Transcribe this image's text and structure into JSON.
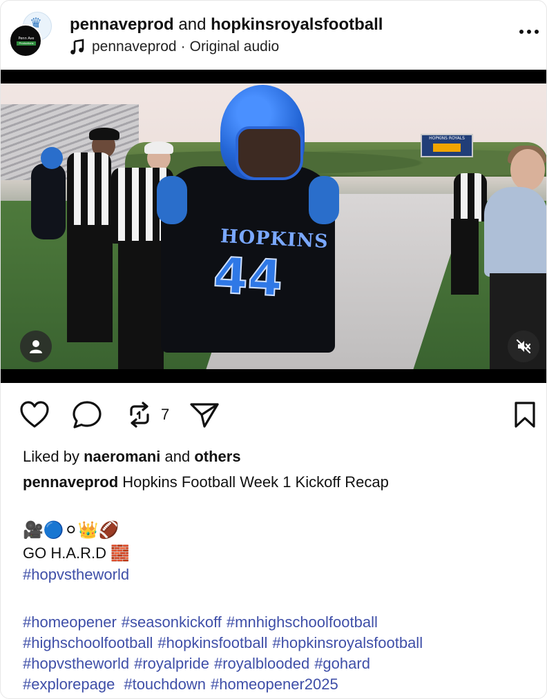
{
  "header": {
    "account_primary": "pennaveprod",
    "joiner": "and",
    "account_collab": "hopkinsroyalsfootball",
    "audio_account": "pennaveprod",
    "audio_separator": "·",
    "audio_label": "Original audio",
    "more_icon": "more-horizontal-icon",
    "avatar_text_line1": "Penn Ave",
    "avatar_text_line2": "Productions"
  },
  "media": {
    "scoreboard_text": "HOPKINS ROYALS",
    "jersey_name": "HOPKINS",
    "jersey_number": "44",
    "user_icon": "person-icon",
    "mute_icon": "speaker-muted-icon"
  },
  "actions": {
    "like_icon": "heart-icon",
    "comment_icon": "comment-bubble-icon",
    "repost_icon": "repost-icon",
    "repost_count": "7",
    "share_icon": "paper-plane-icon",
    "save_icon": "bookmark-icon"
  },
  "post": {
    "liked_prefix": "Liked by",
    "liked_user": "naeromani",
    "liked_and": "and",
    "liked_others": "others",
    "caption_user": "pennaveprod",
    "caption_text": "Hopkins Football Week 1 Kickoff Recap",
    "emoji_line": "🎥🔵⚪👑🏈",
    "go_hard": "GO H.A.R.D 🧱",
    "hashtag_featured": "#hopvstheworld",
    "hashtags": [
      [
        "#homeopener",
        "#seasonkickoff",
        "#mnhighschoolfootball"
      ],
      [
        "#highschoolfootball",
        "#hopkinsfootball",
        "#hopkinsroyalsfootball"
      ],
      [
        "#hopvstheworld",
        "#royalpride",
        "#royalblooded",
        "#gohard"
      ],
      [
        "#explorepage",
        "#touchdown",
        "#homeopener2025"
      ]
    ]
  },
  "colors": {
    "hashtag": "#3f4fa8",
    "jersey_blue": "#2f78e6",
    "helmet_blue": "#2466d6"
  }
}
